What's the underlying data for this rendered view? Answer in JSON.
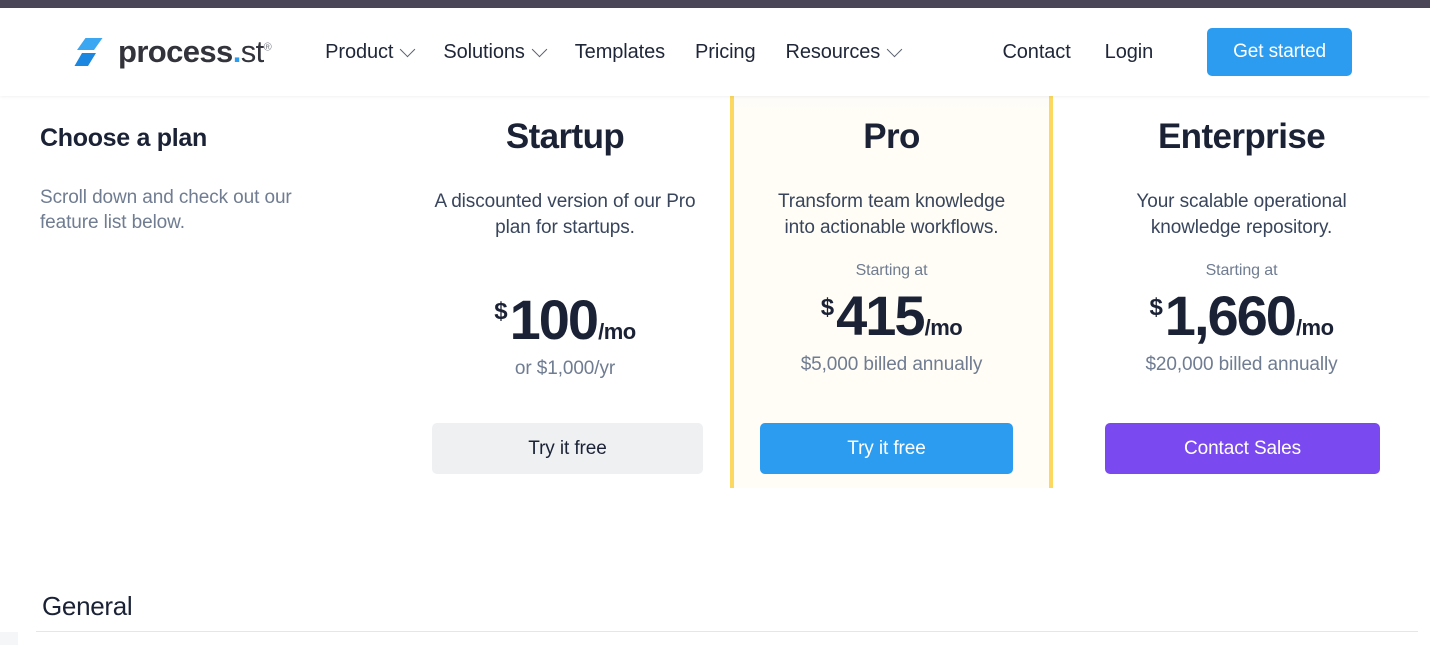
{
  "brand": {
    "logo_text": "process",
    "logo_dot": ".",
    "logo_suffix": "st",
    "logo_registered": "®",
    "accent_blue": "#2b9cf0",
    "accent_purple": "#7b49f0",
    "highlight_yellow": "#fcd860",
    "highlight_bg": "#fffdf5"
  },
  "header": {
    "nav": [
      {
        "label": "Product",
        "has_dropdown": true
      },
      {
        "label": "Solutions",
        "has_dropdown": true
      },
      {
        "label": "Templates",
        "has_dropdown": false
      },
      {
        "label": "Pricing",
        "has_dropdown": false
      },
      {
        "label": "Resources",
        "has_dropdown": true
      }
    ],
    "contact_label": "Contact",
    "login_label": "Login",
    "cta_label": "Get started"
  },
  "intro": {
    "title": "Choose a plan",
    "subtitle": "Scroll down and check out our feature list below."
  },
  "plans": [
    {
      "name": "Startup",
      "description": "A discounted version of our Pro plan for startups.",
      "starting_at": "",
      "currency": "$",
      "amount": "100",
      "period": "/mo",
      "note": "or $1,000/yr",
      "button_label": "Try it free",
      "highlighted": false
    },
    {
      "name": "Pro",
      "description": "Transform team knowledge into actionable workflows.",
      "starting_at": "Starting at",
      "currency": "$",
      "amount": "415",
      "period": "/mo",
      "note": "$5,000 billed annually",
      "button_label": "Try it free",
      "highlighted": true
    },
    {
      "name": "Enterprise",
      "description": "Your scalable operational knowledge repository.",
      "starting_at": "Starting at",
      "currency": "$",
      "amount": "1,660",
      "period": "/mo",
      "note": "$20,000 billed annually",
      "button_label": "Contact Sales",
      "highlighted": false
    }
  ],
  "features": {
    "section_title": "General"
  }
}
